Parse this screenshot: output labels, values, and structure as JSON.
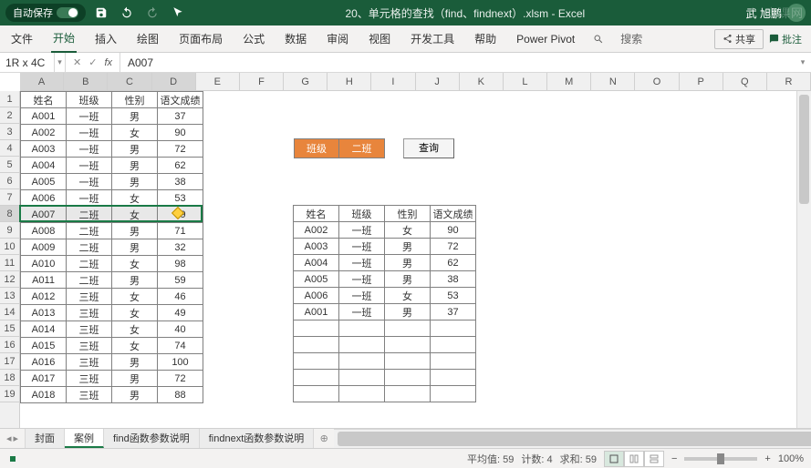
{
  "titlebar": {
    "autosave_label": "自动保存",
    "filename": "20、单元格的查找（find、findnext）.xlsm - Excel",
    "user": "武 旭鹏",
    "watermark": "虎课网"
  },
  "ribbon": {
    "tabs": [
      "文件",
      "开始",
      "插入",
      "绘图",
      "页面布局",
      "公式",
      "数据",
      "审阅",
      "视图",
      "开发工具",
      "帮助",
      "Power Pivot"
    ],
    "search_label": "搜索",
    "share": "共享",
    "comments": "批注"
  },
  "formula_bar": {
    "name_box": "1R x 4C",
    "fx": "fx",
    "value": "A007"
  },
  "columns": [
    "A",
    "B",
    "C",
    "D",
    "E",
    "F",
    "G",
    "H",
    "I",
    "J",
    "K",
    "L",
    "M",
    "N",
    "O",
    "P",
    "Q",
    "R"
  ],
  "rows_visible": 19,
  "main_table": {
    "headers": [
      "姓名",
      "班级",
      "性别",
      "语文成绩"
    ],
    "rows": [
      [
        "A001",
        "一班",
        "男",
        "37"
      ],
      [
        "A002",
        "一班",
        "女",
        "90"
      ],
      [
        "A003",
        "一班",
        "男",
        "72"
      ],
      [
        "A004",
        "一班",
        "男",
        "62"
      ],
      [
        "A005",
        "一班",
        "男",
        "38"
      ],
      [
        "A006",
        "一班",
        "女",
        "53"
      ],
      [
        "A007",
        "二班",
        "女",
        "59"
      ],
      [
        "A008",
        "二班",
        "男",
        "71"
      ],
      [
        "A009",
        "二班",
        "男",
        "32"
      ],
      [
        "A010",
        "二班",
        "女",
        "98"
      ],
      [
        "A011",
        "二班",
        "男",
        "59"
      ],
      [
        "A012",
        "三班",
        "女",
        "46"
      ],
      [
        "A013",
        "三班",
        "女",
        "49"
      ],
      [
        "A014",
        "三班",
        "女",
        "40"
      ],
      [
        "A015",
        "三班",
        "女",
        "74"
      ],
      [
        "A016",
        "三班",
        "男",
        "100"
      ],
      [
        "A017",
        "三班",
        "男",
        "72"
      ],
      [
        "A018",
        "三班",
        "男",
        "88"
      ]
    ],
    "selected_row_index": 6
  },
  "filter": {
    "label": "班级",
    "value": "二班",
    "button": "查询"
  },
  "result_table": {
    "headers": [
      "姓名",
      "班级",
      "性别",
      "语文成绩"
    ],
    "rows": [
      [
        "A002",
        "一班",
        "女",
        "90"
      ],
      [
        "A003",
        "一班",
        "男",
        "72"
      ],
      [
        "A004",
        "一班",
        "男",
        "62"
      ],
      [
        "A005",
        "一班",
        "男",
        "38"
      ],
      [
        "A006",
        "一班",
        "女",
        "53"
      ],
      [
        "A001",
        "一班",
        "男",
        "37"
      ],
      [
        "",
        "",
        "",
        ""
      ],
      [
        "",
        "",
        "",
        ""
      ],
      [
        "",
        "",
        "",
        ""
      ],
      [
        "",
        "",
        "",
        ""
      ],
      [
        "",
        "",
        "",
        ""
      ]
    ]
  },
  "sheet_tabs": {
    "tabs": [
      "封面",
      "案例",
      "find函数参数说明",
      "findnext函数参数说明"
    ],
    "active": 1
  },
  "statusbar": {
    "avg_label": "平均值:",
    "avg": "59",
    "count_label": "计数:",
    "count": "4",
    "sum_label": "求和:",
    "sum": "59",
    "zoom": "100%"
  }
}
